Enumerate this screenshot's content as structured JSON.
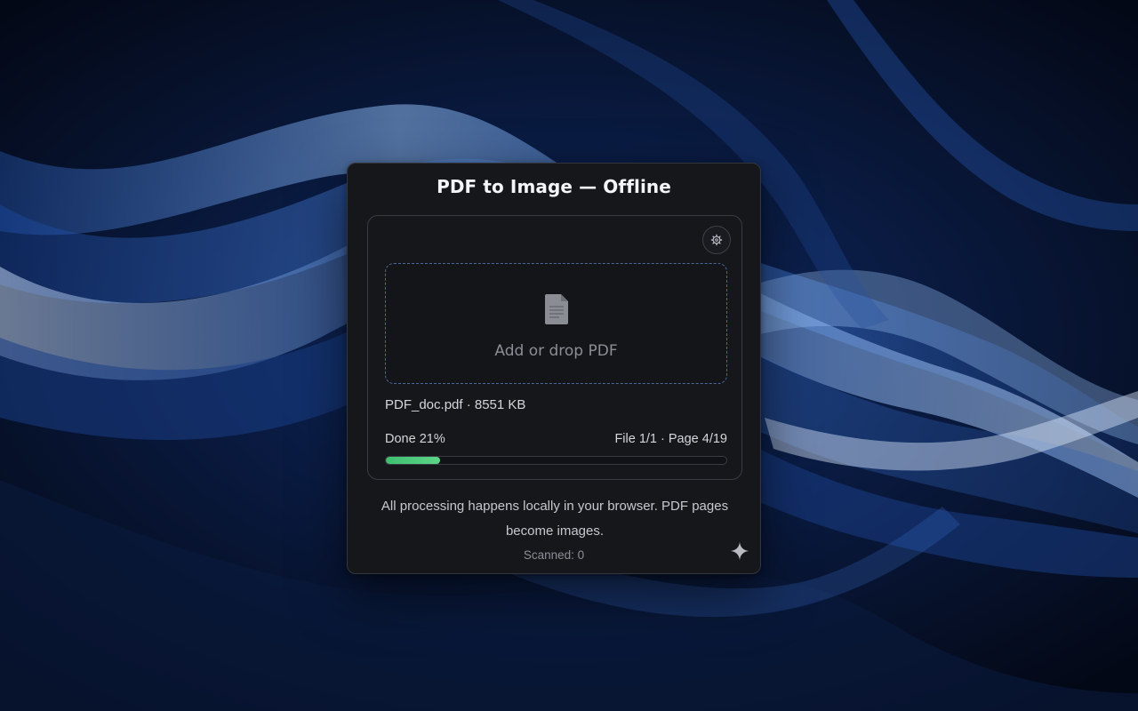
{
  "app": {
    "title": "PDF to Image — Offline"
  },
  "dropzone": {
    "label": "Add or drop PDF",
    "icon": "document-icon"
  },
  "settings": {
    "icon": "gear-icon"
  },
  "file": {
    "info": "PDF_doc.pdf · 8551 KB"
  },
  "progress": {
    "status": "Done 21%",
    "detail": "File 1/1 · Page 4/19",
    "fraction": 0.16,
    "color": "#4cc97a"
  },
  "footer": {
    "notice": "All processing happens locally in your browser. PDF pages become images.",
    "scanned": "Scanned: 0"
  },
  "assistant": {
    "icon": "sparkle-icon"
  }
}
